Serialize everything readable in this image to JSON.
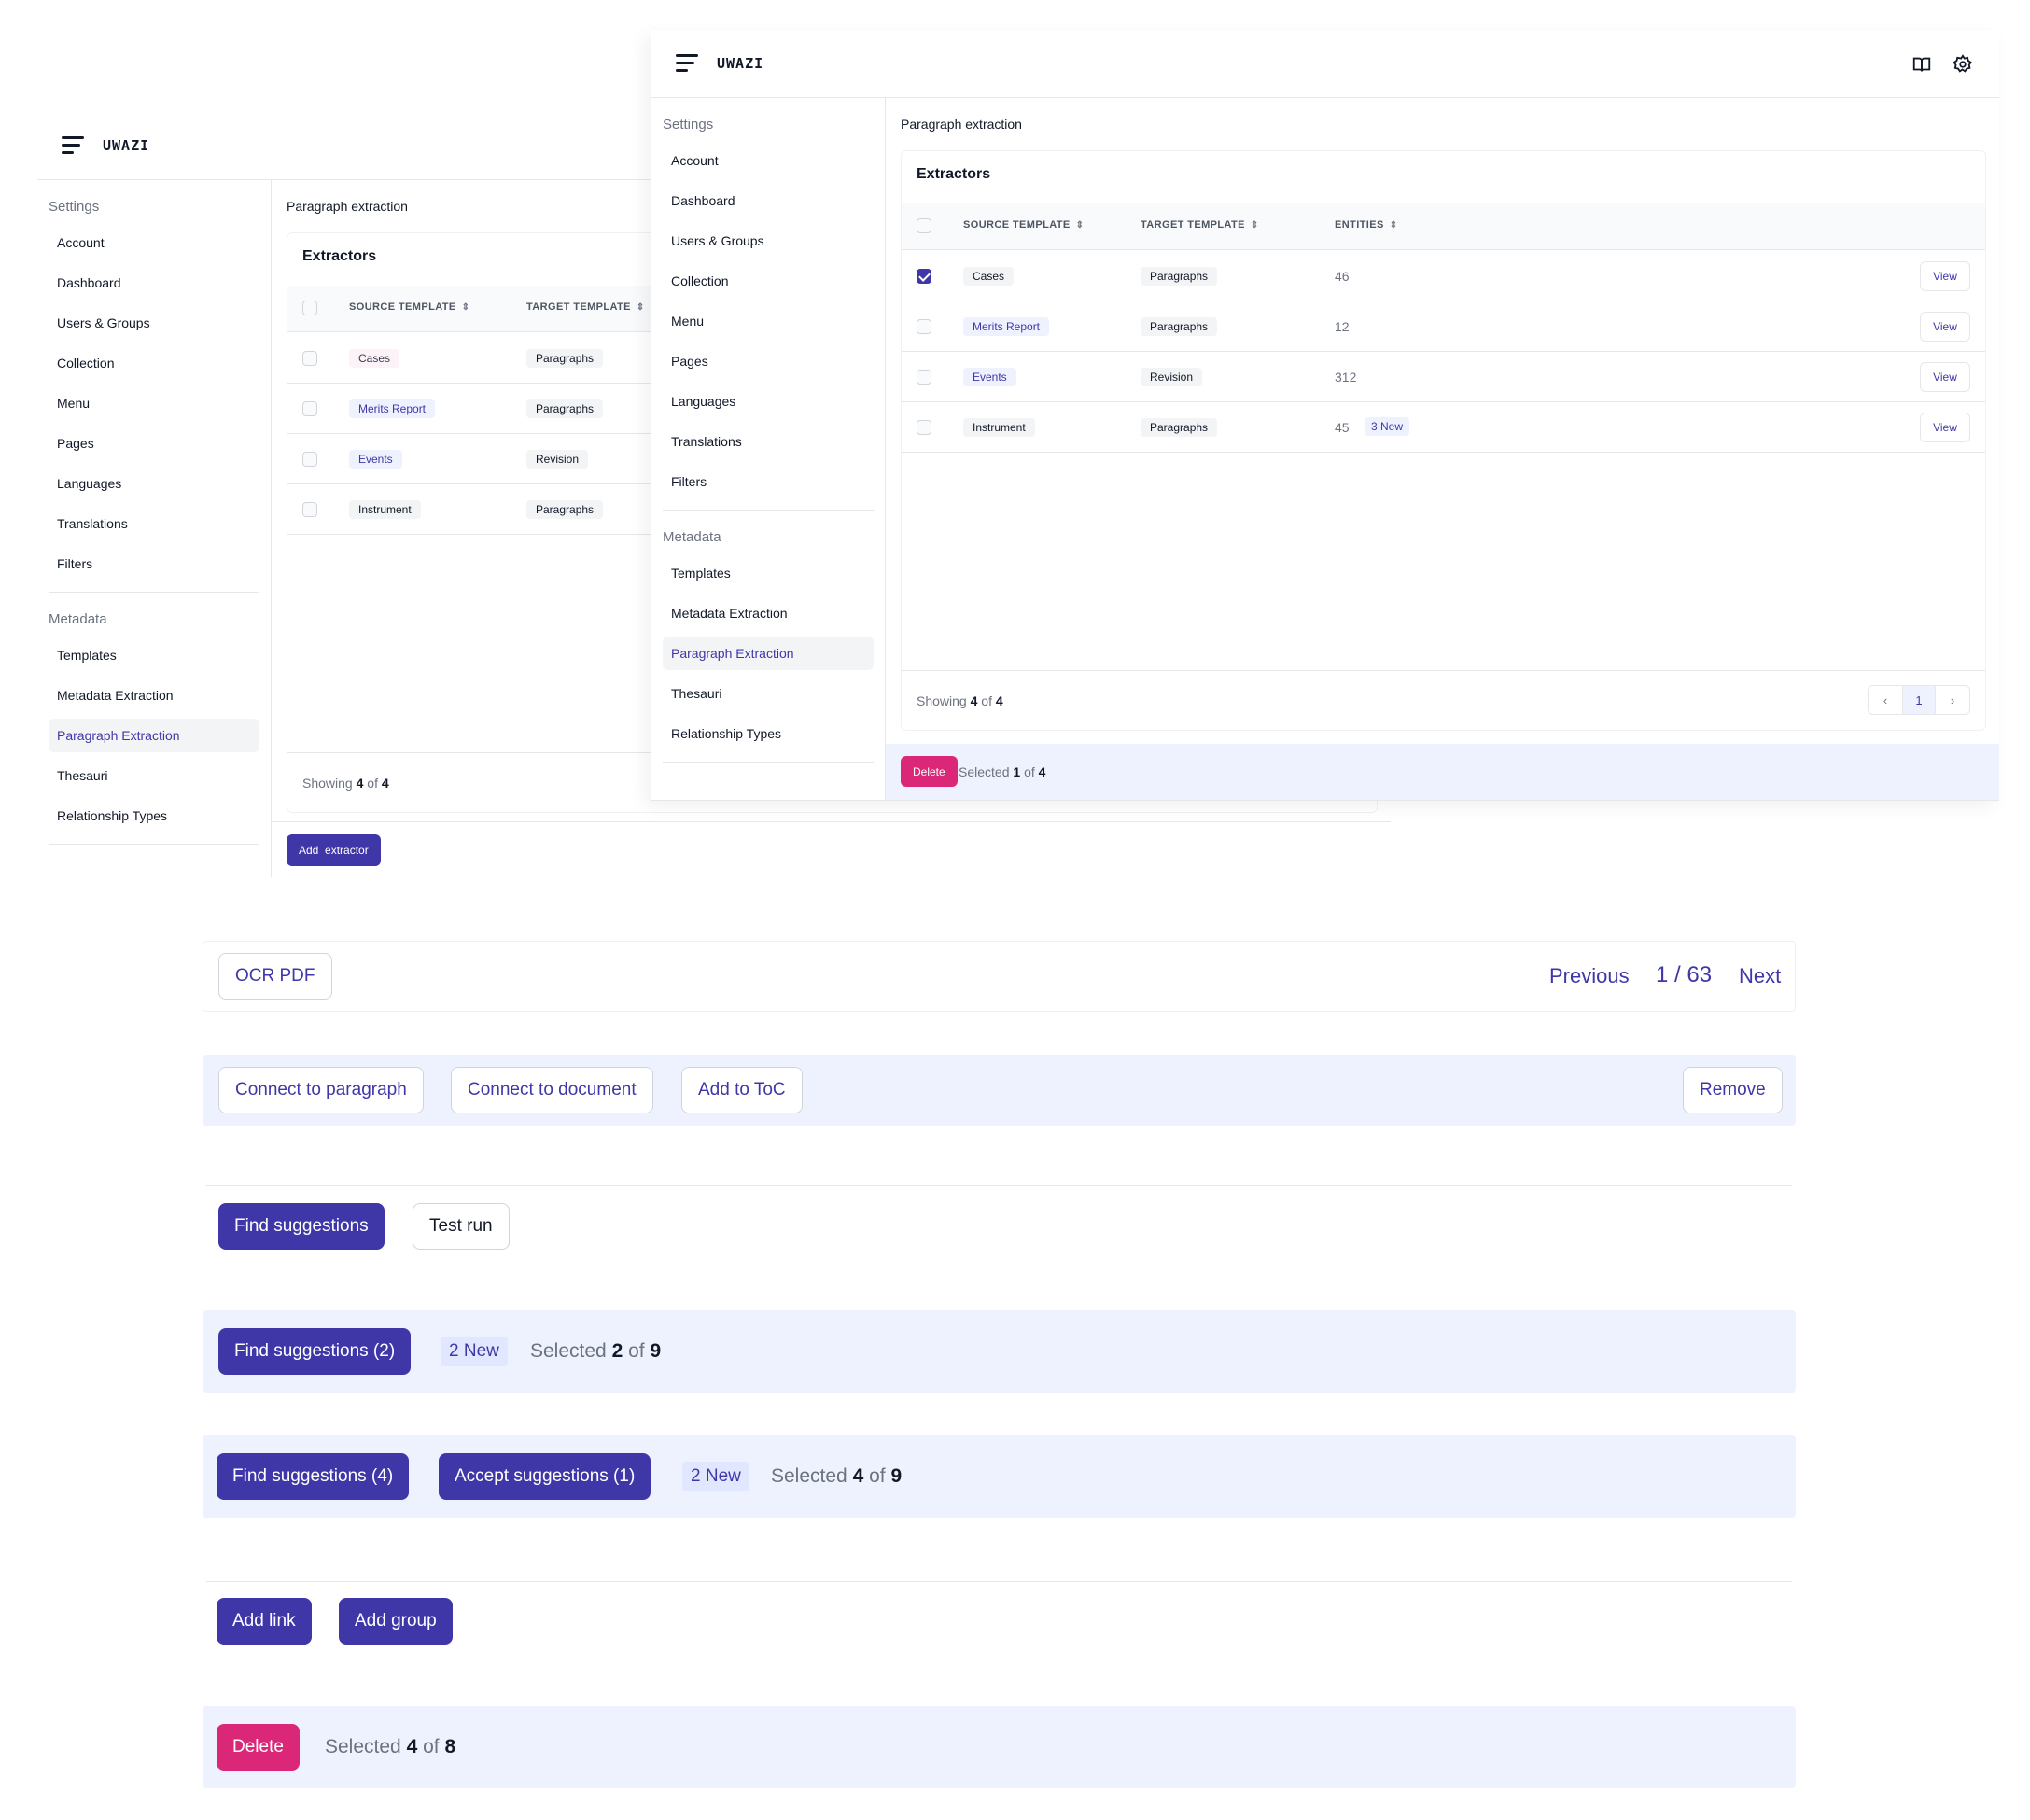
{
  "app": {
    "logo": "UWAZI",
    "breadcrumb": "Paragraph extraction",
    "sidebar": {
      "settings_heading": "Settings",
      "settings_items": [
        "Account",
        "Dashboard",
        "Users & Groups",
        "Collection",
        "Menu",
        "Pages",
        "Languages",
        "Translations",
        "Filters"
      ],
      "metadata_heading": "Metadata",
      "metadata_items": [
        "Templates",
        "Metadata Extraction",
        "Paragraph Extraction",
        "Thesauri",
        "Relationship Types"
      ],
      "active_item": "Paragraph Extraction"
    },
    "header_icons": [
      "book-icon",
      "gear-icon"
    ],
    "table": {
      "title": "Extractors",
      "columns": [
        "SOURCE TEMPLATE",
        "TARGET TEMPLATE",
        "ENTITIES"
      ],
      "rows": [
        {
          "source": "Cases",
          "target": "Paragraphs",
          "entities": "46",
          "new": "",
          "checked": true
        },
        {
          "source": "Merits Report",
          "target": "Paragraphs",
          "entities": "12",
          "new": "",
          "checked": false
        },
        {
          "source": "Events",
          "target": "Revision",
          "entities": "312",
          "new": "",
          "checked": false
        },
        {
          "source": "Instrument",
          "target": "Paragraphs",
          "entities": "45",
          "new": "3 New",
          "checked": false
        }
      ],
      "view_label": "View",
      "showing": {
        "prefix": "Showing",
        "count": "4",
        "of": "of",
        "total": "4"
      },
      "pagination": {
        "current_page": "1"
      }
    },
    "back_action": {
      "add_extractor": "Add  extractor"
    },
    "front_action": {
      "delete": "Delete",
      "prefix": "Selected",
      "count": "1",
      "of": "of",
      "total": "4"
    }
  },
  "strips": {
    "pdf_bar": {
      "ocr_button": "OCR PDF",
      "previous": "Previous",
      "page_indicator": "1 / 63",
      "next": "Next"
    },
    "connection_bar": {
      "connect_paragraph": "Connect to paragraph",
      "connect_document": "Connect to document",
      "add_toc": "Add to ToC",
      "remove": "Remove"
    },
    "suggestions_bar": {
      "find": "Find suggestions",
      "test_run": "Test run"
    },
    "suggestions_selected": {
      "find": "Find suggestions (2)",
      "new": "2 New",
      "prefix": "Selected",
      "count": "2",
      "of": "of",
      "total": "9"
    },
    "suggestions_accept": {
      "find": "Find suggestions (4)",
      "accept": "Accept suggestions (1)",
      "new": "2 New",
      "prefix": "Selected",
      "count": "4",
      "of": "of",
      "total": "9"
    },
    "links_bar": {
      "add_link": "Add link",
      "add_group": "Add group"
    },
    "delete_bar": {
      "delete": "Delete",
      "prefix": "Selected",
      "count": "4",
      "of": "of",
      "total": "8"
    }
  },
  "colors": {
    "primary": "#3f37a8",
    "danger": "#db2777",
    "action_bar_bg": "#eef2ff",
    "new_badge_bg": "#e0e7ff"
  }
}
